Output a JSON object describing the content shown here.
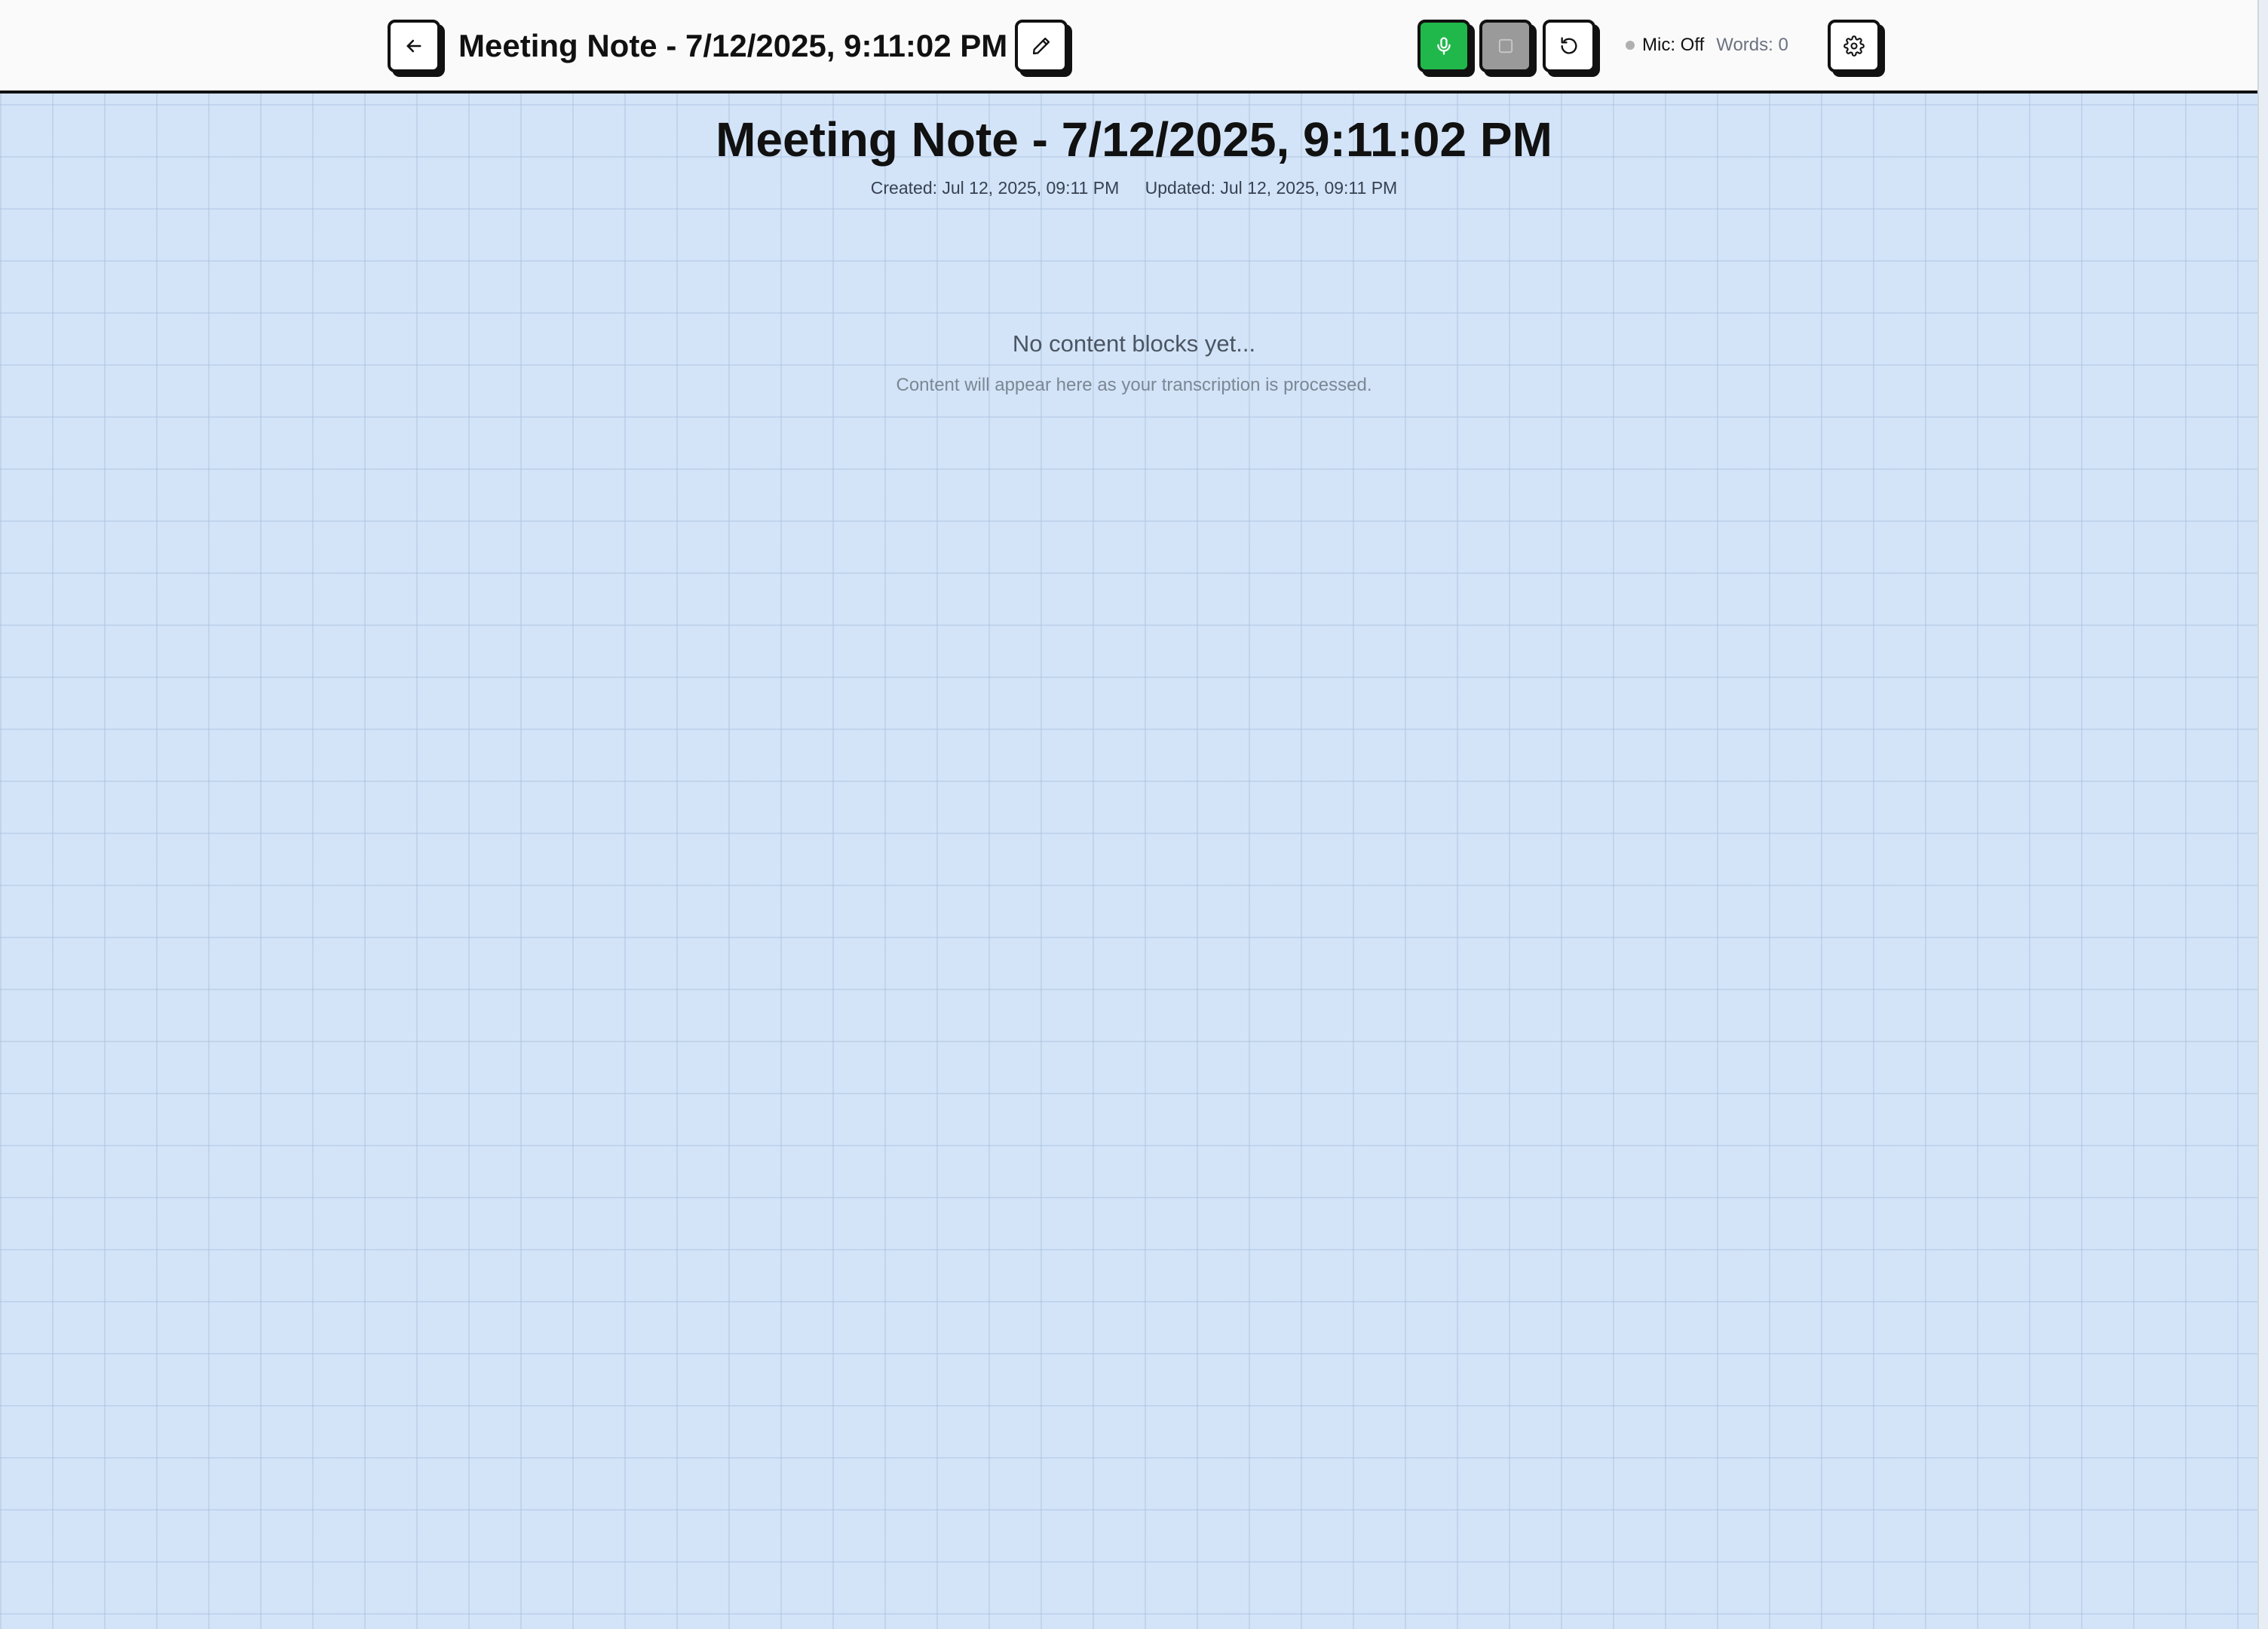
{
  "header": {
    "title": "Meeting Note - 7/12/2025, 9:11:02 PM",
    "mic_status": "Mic: Off",
    "words_count": "Words: 0",
    "icons": {
      "back": "arrow-left-icon",
      "edit": "pencil-icon",
      "mic": "microphone-icon",
      "stop": "stop-square-icon",
      "reset": "rotate-ccw-icon",
      "settings": "gear-icon"
    }
  },
  "note": {
    "title": "Meeting Note - 7/12/2025, 9:11:02 PM",
    "created": "Created: Jul 12, 2025, 09:11 PM",
    "updated": "Updated: Jul 12, 2025, 09:11 PM"
  },
  "empty_state": {
    "title": "No content blocks yet...",
    "subtitle": "Content will appear here as your transcription is processed."
  },
  "colors": {
    "background": "#d3e4f8",
    "mic_active": "#20b84a",
    "stop_disabled": "#9a9a9a",
    "border": "#111111"
  }
}
